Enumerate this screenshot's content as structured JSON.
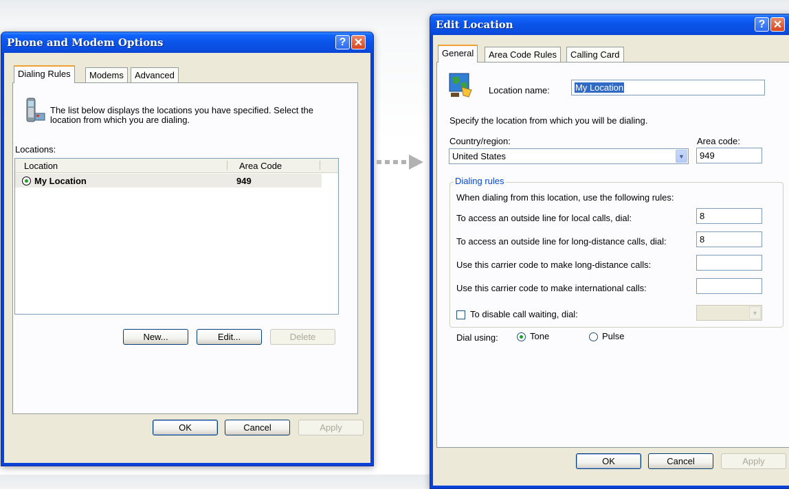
{
  "left_window": {
    "title": "Phone and Modem Options",
    "help_icon": "help-question-icon",
    "close_icon": "close-x-icon",
    "tabs": [
      {
        "label": "Dialing Rules",
        "active": true
      },
      {
        "label": "Modems",
        "active": false
      },
      {
        "label": "Advanced",
        "active": false
      }
    ],
    "description": "The list below displays the locations you have specified. Select the location from which you are dialing.",
    "locations_label": "Locations:",
    "table": {
      "columns": [
        "Location",
        "Area Code"
      ],
      "rows": [
        {
          "location": "My Location",
          "area_code": "949",
          "selected": true
        }
      ]
    },
    "buttons": {
      "new": "New...",
      "edit": "Edit...",
      "delete": "Delete"
    },
    "footer": {
      "ok": "OK",
      "cancel": "Cancel",
      "apply": "Apply"
    }
  },
  "arrow_icon": "dotted-arrow-right-icon",
  "right_window": {
    "title": "Edit Location",
    "tabs": [
      {
        "label": "General",
        "active": true
      },
      {
        "label": "Area Code Rules",
        "active": false
      },
      {
        "label": "Calling Card",
        "active": false
      }
    ],
    "location_name_label": "Location name:",
    "location_name_value": "My Location",
    "specify_text": "Specify the location from which you will be dialing.",
    "country_label": "Country/region:",
    "country_value": "United States",
    "area_code_label": "Area code:",
    "area_code_value": "949",
    "dialing_rules": {
      "group_label": "Dialing rules",
      "intro": "When dialing from this location, use the following rules:",
      "local_label": "To access an outside line for local calls, dial:",
      "local_value": "8",
      "long_distance_label": "To access an outside line for long-distance calls, dial:",
      "long_distance_value": "8",
      "carrier_ld_label": "Use this carrier code to make long-distance calls:",
      "carrier_ld_value": "",
      "carrier_intl_label": "Use this carrier code to make international calls:",
      "carrier_intl_value": ""
    },
    "call_waiting_label": "To disable call waiting, dial:",
    "call_waiting_checked": false,
    "dial_using_label": "Dial using:",
    "tone_label": "Tone",
    "pulse_label": "Pulse",
    "dial_mode": "Tone",
    "footer": {
      "ok": "OK",
      "cancel": "Cancel",
      "apply": "Apply"
    }
  }
}
